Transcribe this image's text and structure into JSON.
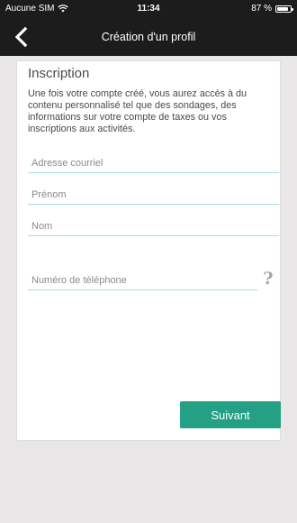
{
  "status_bar": {
    "carrier": "Aucune SIM",
    "time": "11:34",
    "battery": "87 %",
    "battery_level": 0.87,
    "wifi_icon": "wifi-icon",
    "battery_icon": "battery-icon"
  },
  "nav": {
    "title": "Création d'un profil",
    "back_icon": "chevron-left-icon"
  },
  "form": {
    "title": "Inscription",
    "description": "Une fois votre compte créé, vous aurez accès à du contenu personnalisé tel que des sondages, des informations sur votre compte de taxes ou vos inscriptions aux activités.",
    "fields": {
      "email": {
        "placeholder": "Adresse courriel",
        "value": ""
      },
      "first_name": {
        "placeholder": "Prénom",
        "value": ""
      },
      "last_name": {
        "placeholder": "Nom",
        "value": ""
      },
      "phone": {
        "placeholder": "Numéro de téléphone",
        "value": ""
      }
    },
    "help_glyph": "?",
    "submit_label": "Suivant"
  },
  "colors": {
    "bar_background": "#1c1c1c",
    "page_background": "#e9e7e8",
    "accent": "#24a085",
    "field_underline": "#a7dbe6"
  }
}
